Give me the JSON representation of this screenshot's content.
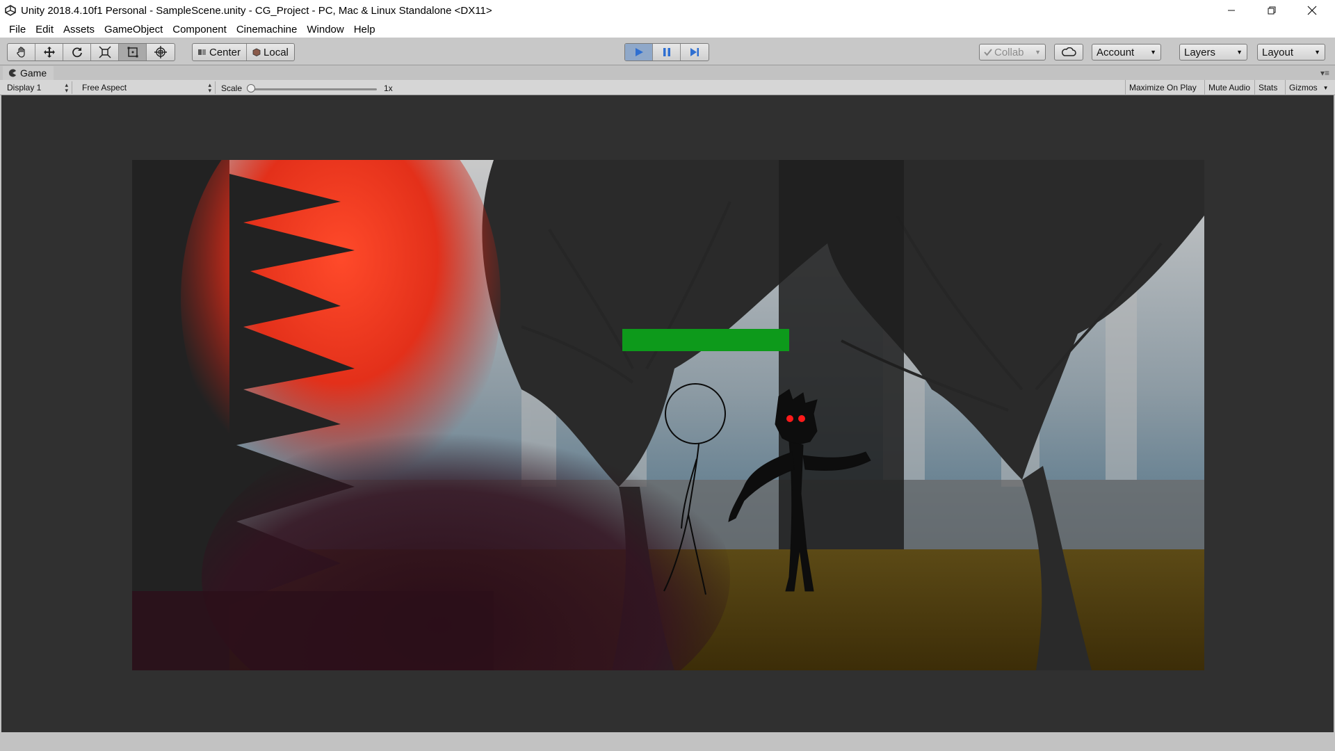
{
  "window": {
    "title": "Unity 2018.4.10f1 Personal - SampleScene.unity - CG_Project - PC, Mac & Linux Standalone <DX11>"
  },
  "menu": [
    "File",
    "Edit",
    "Assets",
    "GameObject",
    "Component",
    "Cinemachine",
    "Window",
    "Help"
  ],
  "toolbar": {
    "tools": [
      "hand-tool-icon",
      "move-tool-icon",
      "rotate-tool-icon",
      "scale-tool-icon",
      "rect-tool-icon",
      "transform-tool-icon"
    ],
    "pivot_mode": "Center",
    "pivot_rotation": "Local",
    "play_active": true,
    "collab": "Collab",
    "account": "Account",
    "layers": "Layers",
    "layout": "Layout"
  },
  "game_panel": {
    "tab_label": "Game",
    "display": "Display 1",
    "aspect": "Free Aspect",
    "scale_label": "Scale",
    "scale_value": "1x",
    "buttons": {
      "maximize": "Maximize On Play",
      "mute": "Mute Audio",
      "stats": "Stats",
      "gizmos": "Gizmos"
    }
  },
  "game": {
    "health_bar_color": "#0d9a1b",
    "health_fraction": 1.0,
    "fire_color": "#e8331c",
    "enemy_eye_color": "#ff1a1a"
  }
}
